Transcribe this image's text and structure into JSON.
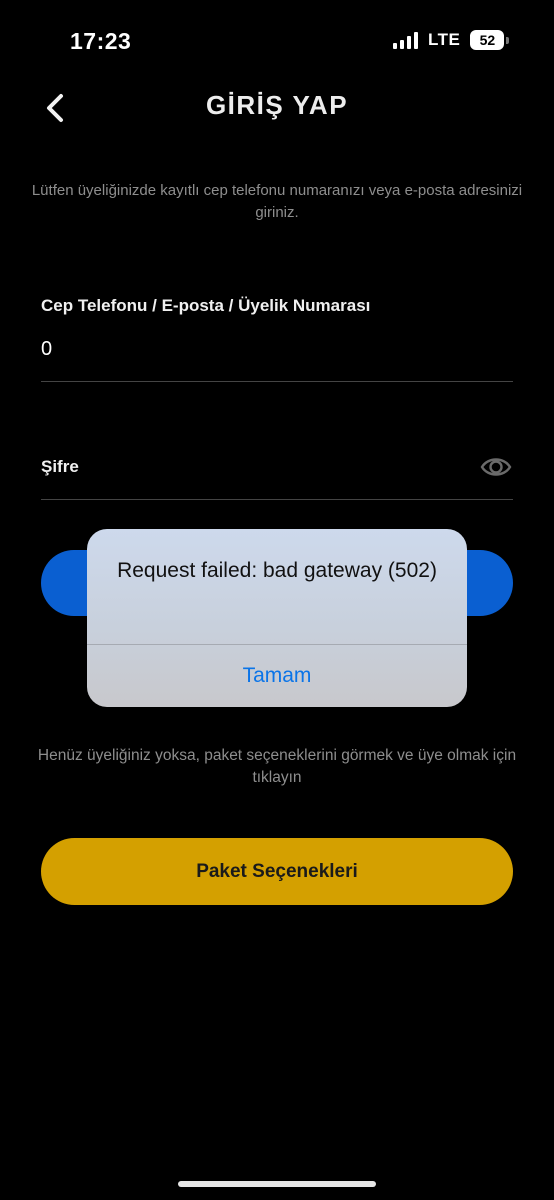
{
  "status_bar": {
    "time": "17:23",
    "network": "LTE",
    "battery": "52"
  },
  "header": {
    "title": "GİRİŞ YAP"
  },
  "instructions": "Lütfen üyeliğinizde kayıtlı cep telefonu numaranızı veya e-posta adresinizi giriniz.",
  "form": {
    "identifier_label": "Cep Telefonu / E-posta / Üyelik Numarası",
    "identifier_value": "0",
    "password_label": "Şifre"
  },
  "signup_hint": "Henüz üyeliğiniz yoksa, paket seçeneklerini görmek ve üye olmak için tıklayın",
  "packages_button": "Paket Seçenekleri",
  "alert": {
    "message": "Request failed: bad gateway (502)",
    "button": "Tamam"
  },
  "colors": {
    "background": "#000000",
    "primary_blue": "#0a5fd1",
    "accent_gold": "#d4a000",
    "alert_button_blue": "#0a74e8"
  }
}
